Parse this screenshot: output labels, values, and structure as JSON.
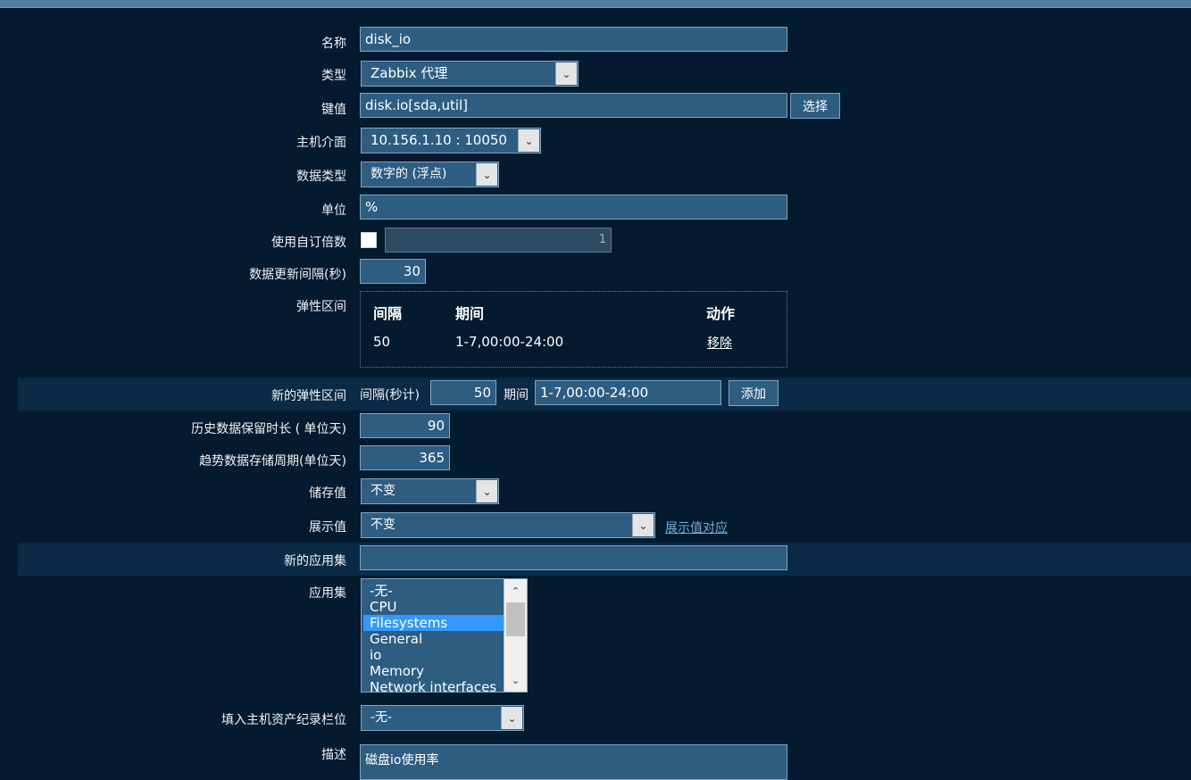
{
  "form": {
    "name": {
      "label": "名称",
      "value": "disk_io"
    },
    "type": {
      "label": "类型",
      "value": "Zabbix 代理"
    },
    "key": {
      "label": "键值",
      "value": "disk.io[sda,util]",
      "select_button": "选择"
    },
    "interface": {
      "label": "主机介面",
      "value": "10.156.1.10 : 10050"
    },
    "data_type": {
      "label": "数据类型",
      "value": "数字的 (浮点)"
    },
    "units": {
      "label": "单位",
      "value": "%"
    },
    "multiplier": {
      "label": "使用自订倍数",
      "value": "1",
      "checked": false
    },
    "update_interval": {
      "label": "数据更新间隔(秒)",
      "value": "30"
    },
    "flex_intervals": {
      "label": "弹性区间",
      "headers": {
        "interval": "间隔",
        "period": "期间",
        "action": "动作"
      },
      "rows": [
        {
          "interval": "50",
          "period": "1-7,00:00-24:00",
          "action": "移除"
        }
      ]
    },
    "new_flex": {
      "label": "新的弹性区间",
      "interval_label": "间隔(秒计)",
      "interval_value": "50",
      "period_label": "期间",
      "period_value": "1-7,00:00-24:00",
      "add_button": "添加"
    },
    "history": {
      "label": "历史数据保留时长 ( 单位天)",
      "value": "90"
    },
    "trends": {
      "label": "趋势数据存储周期(单位天)",
      "value": "365"
    },
    "store_value": {
      "label": "储存值",
      "value": "不变"
    },
    "show_value": {
      "label": "展示值",
      "value": "不变",
      "link": "展示值对应"
    },
    "new_application": {
      "label": "新的应用集",
      "value": ""
    },
    "applications": {
      "label": "应用集",
      "options": [
        "-无-",
        "CPU",
        "Filesystems",
        "General",
        "io",
        "Memory",
        "Network interfaces"
      ],
      "selected": "Filesystems"
    },
    "inventory": {
      "label": "填入主机资产纪录栏位",
      "value": "-无-"
    },
    "description": {
      "label": "描述",
      "value": "磁盘io使用率"
    }
  }
}
